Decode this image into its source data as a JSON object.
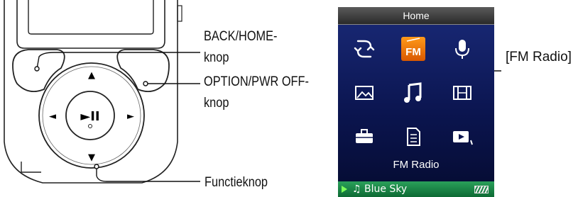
{
  "callouts": {
    "back_home": [
      "BACK/HOME-",
      "knop"
    ],
    "option_pwr": [
      "OPTION/PWR OFF-",
      "knop"
    ],
    "function_button": "Functieknop",
    "fm_radio": "[FM Radio]"
  },
  "screen": {
    "title": "Home",
    "icons": [
      "shuffle-icon",
      "fm-radio-icon",
      "microphone-icon",
      "photo-icon",
      "music-note-icon",
      "film-icon",
      "toolbox-icon",
      "document-icon",
      "video-play-icon"
    ],
    "fm_badge": "FM",
    "selected_label": "FM Radio",
    "now_playing": "♫ Blue Sky"
  },
  "player": {
    "control_glyphs": {
      "up": "▲",
      "down": "▼",
      "left": "◄",
      "right": "►",
      "center": "►II"
    }
  },
  "colors": {
    "screen_bg": "#0b1550",
    "accent": "#ff8a00",
    "now_playing_bar": "#1a8a48"
  }
}
